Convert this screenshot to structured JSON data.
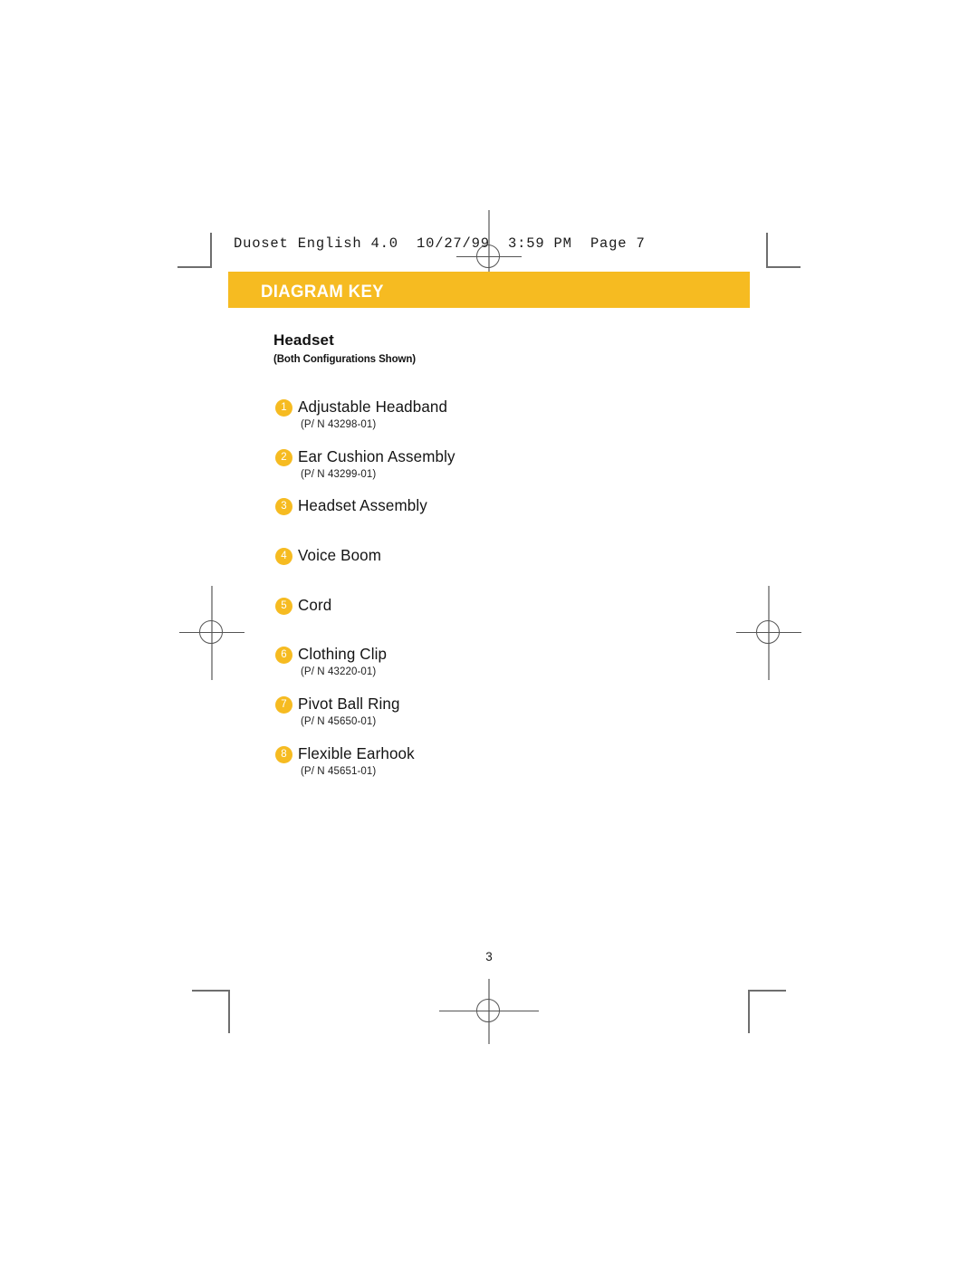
{
  "print_slug": "Duoset English 4.0  10/27/99  3:59 PM  Page 7",
  "banner": {
    "title": "DIAGRAM KEY",
    "color": "#f6bb21"
  },
  "section": {
    "heading": "Headset",
    "subheading": "(Both Configurations Shown)"
  },
  "parts": [
    {
      "number": "1",
      "label": "Adjustable Headband",
      "part_number": "(P/ N 43298-01)"
    },
    {
      "number": "2",
      "label": "Ear Cushion Assembly",
      "part_number": "(P/ N 43299-01)"
    },
    {
      "number": "3",
      "label": "Headset Assembly",
      "part_number": ""
    },
    {
      "number": "4",
      "label": "Voice Boom",
      "part_number": ""
    },
    {
      "number": "5",
      "label": "Cord",
      "part_number": ""
    },
    {
      "number": "6",
      "label": "Clothing Clip",
      "part_number": "(P/ N 43220-01)"
    },
    {
      "number": "7",
      "label": "Pivot Ball Ring",
      "part_number": "(P/ N 45650-01)"
    },
    {
      "number": "8",
      "label": "Flexible Earhook",
      "part_number": "(P/ N 45651-01)"
    }
  ],
  "folio": "3",
  "colors": {
    "accent": "#f6bb21",
    "text": "#141414",
    "crop_mark": "#6e6e6e"
  }
}
